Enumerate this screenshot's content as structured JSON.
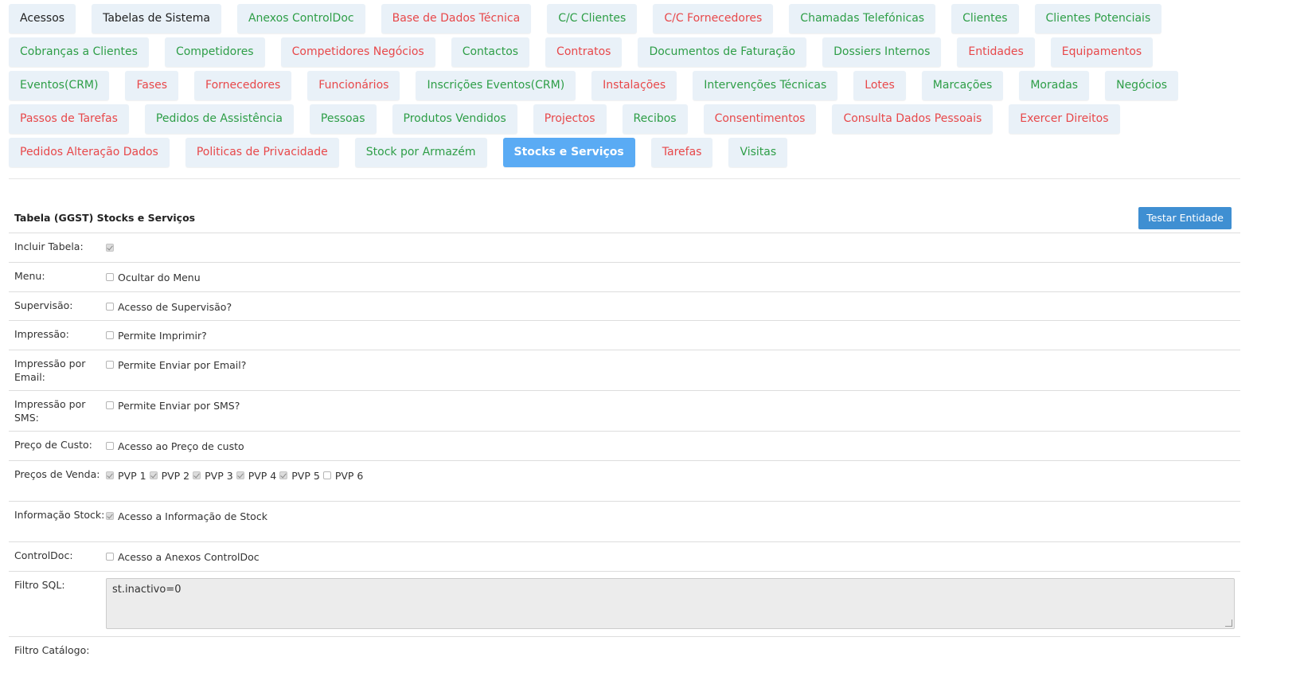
{
  "tabs": [
    {
      "label": "Acessos",
      "color": "dark"
    },
    {
      "label": "Tabelas de Sistema",
      "color": "dark"
    },
    {
      "label": "Anexos ControlDoc",
      "color": "green"
    },
    {
      "label": "Base de Dados Técnica",
      "color": "red"
    },
    {
      "label": "C/C Clientes",
      "color": "green"
    },
    {
      "label": "C/C Fornecedores",
      "color": "red"
    },
    {
      "label": "Chamadas Telefónicas",
      "color": "green"
    },
    {
      "label": "Clientes",
      "color": "green"
    },
    {
      "label": "Clientes Potenciais",
      "color": "green"
    },
    {
      "label": "Cobranças a Clientes",
      "color": "green"
    },
    {
      "label": "Competidores",
      "color": "green"
    },
    {
      "label": "Competidores Negócios",
      "color": "red"
    },
    {
      "label": "Contactos",
      "color": "green"
    },
    {
      "label": "Contratos",
      "color": "red"
    },
    {
      "label": "Documentos de Faturação",
      "color": "green"
    },
    {
      "label": "Dossiers Internos",
      "color": "green"
    },
    {
      "label": "Entidades",
      "color": "red"
    },
    {
      "label": "Equipamentos",
      "color": "red"
    },
    {
      "label": "Eventos(CRM)",
      "color": "green"
    },
    {
      "label": "Fases",
      "color": "red"
    },
    {
      "label": "Fornecedores",
      "color": "red"
    },
    {
      "label": "Funcionários",
      "color": "red"
    },
    {
      "label": "Inscrições Eventos(CRM)",
      "color": "green"
    },
    {
      "label": "Instalações",
      "color": "red"
    },
    {
      "label": "Intervenções Técnicas",
      "color": "green"
    },
    {
      "label": "Lotes",
      "color": "red"
    },
    {
      "label": "Marcações",
      "color": "green"
    },
    {
      "label": "Moradas",
      "color": "green"
    },
    {
      "label": "Negócios",
      "color": "green"
    },
    {
      "label": "Passos de Tarefas",
      "color": "red"
    },
    {
      "label": "Pedidos de Assistência",
      "color": "green"
    },
    {
      "label": "Pessoas",
      "color": "green"
    },
    {
      "label": "Produtos Vendidos",
      "color": "green"
    },
    {
      "label": "Projectos",
      "color": "red"
    },
    {
      "label": "Recibos",
      "color": "green"
    },
    {
      "label": "Consentimentos",
      "color": "red"
    },
    {
      "label": "Consulta Dados Pessoais",
      "color": "red"
    },
    {
      "label": "Exercer Direitos",
      "color": "red"
    },
    {
      "label": "Pedidos Alteração Dados",
      "color": "red"
    },
    {
      "label": "Politicas de Privacidade",
      "color": "red"
    },
    {
      "label": "Stock por Armazém",
      "color": "green"
    },
    {
      "label": "Stocks e Serviços",
      "color": "active"
    },
    {
      "label": "Tarefas",
      "color": "red"
    },
    {
      "label": "Visitas",
      "color": "green"
    }
  ],
  "form": {
    "title": "Tabela (GGST) Stocks e Serviços",
    "test_button": "Testar Entidade",
    "incluir_tabela": {
      "label": "Incluir Tabela:",
      "checked": true
    },
    "menu": {
      "label": "Menu:",
      "option": "Ocultar do Menu",
      "checked": false
    },
    "supervisao": {
      "label": "Supervisão:",
      "option": "Acesso de Supervisão?",
      "checked": false
    },
    "impressao": {
      "label": "Impressão:",
      "option": "Permite Imprimir?",
      "checked": false
    },
    "impressao_email": {
      "label": "Impressão por Email:",
      "option": "Permite Enviar por Email?",
      "checked": false
    },
    "impressao_sms": {
      "label": "Impressão por SMS:",
      "option": "Permite Enviar por SMS?",
      "checked": false
    },
    "preco_custo": {
      "label": "Preço de Custo:",
      "option": "Acesso ao Preço de custo",
      "checked": false
    },
    "precos_venda": {
      "label": "Preços de Venda:",
      "options": [
        {
          "label": "PVP 1",
          "checked": true
        },
        {
          "label": "PVP 2",
          "checked": true
        },
        {
          "label": "PVP 3",
          "checked": true
        },
        {
          "label": "PVP 4",
          "checked": true
        },
        {
          "label": "PVP 5",
          "checked": true
        },
        {
          "label": "PVP 6",
          "checked": false
        }
      ]
    },
    "informacao_stock": {
      "label": "Informação Stock:",
      "option": "Acesso a Informação de Stock",
      "checked": true
    },
    "controldoc": {
      "label": "ControlDoc:",
      "option": "Acesso a Anexos ControlDoc",
      "checked": false
    },
    "filtro_sql": {
      "label": "Filtro SQL:",
      "value": "st.inactivo=0"
    },
    "filtro_catalogo": {
      "label": "Filtro Catálogo:"
    }
  },
  "colors": {
    "active_tab": "#5aabf4",
    "tab_bg": "#e9f1f8",
    "green_text": "#2e9e47",
    "red_text": "#e8484a",
    "button": "#3f8fd2"
  }
}
